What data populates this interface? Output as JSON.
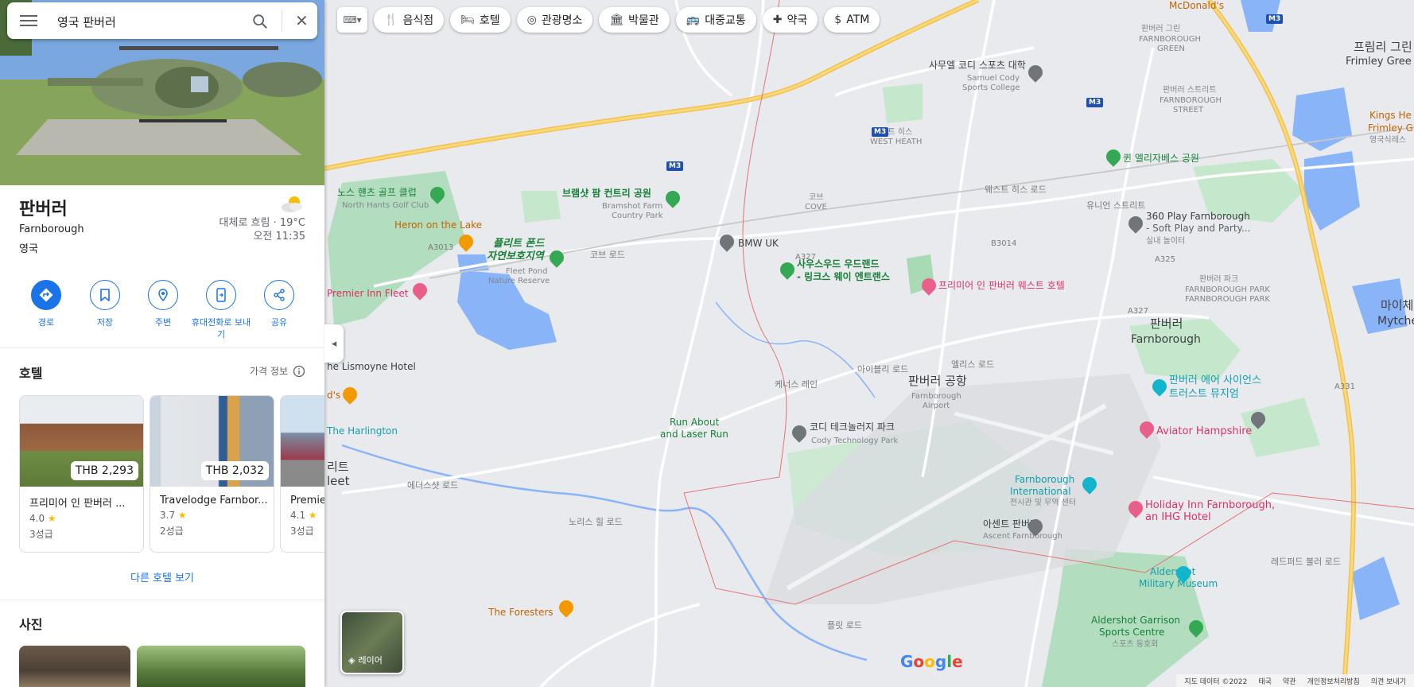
{
  "search": {
    "query": "영국 판버러"
  },
  "place": {
    "name": "판버러",
    "subtitle": "Farnborough",
    "country": "영국",
    "weather_line": "대체로 흐림 · 19°C",
    "time": "오전 11:35"
  },
  "actions": [
    {
      "label": "경로",
      "icon": "directions-icon"
    },
    {
      "label": "저장",
      "icon": "bookmark-icon"
    },
    {
      "label": "주변",
      "icon": "nearby-icon"
    },
    {
      "label": "휴대전화로 보내기",
      "icon": "send-to-phone-icon"
    },
    {
      "label": "공유",
      "icon": "share-icon"
    }
  ],
  "hotels": {
    "title": "호텔",
    "price_info": "가격 정보",
    "items": [
      {
        "price": "THB 2,293",
        "name": "프리미어 인 판버러 ...",
        "rating": "4.0",
        "class": "3성급"
      },
      {
        "price": "THB 2,032",
        "name": "Travelodge Farnbor...",
        "rating": "3.7",
        "class": "2성급"
      },
      {
        "price": "",
        "name": "Premier...",
        "rating": "4.1",
        "class": "3성급"
      }
    ],
    "more": "다른 호텔 보기"
  },
  "photos": {
    "title": "사진"
  },
  "chips": [
    {
      "label": "음식점",
      "icon": "fork-knife-icon"
    },
    {
      "label": "호텔",
      "icon": "bed-icon"
    },
    {
      "label": "관광명소",
      "icon": "camera-icon"
    },
    {
      "label": "박물관",
      "icon": "museum-icon"
    },
    {
      "label": "대중교통",
      "icon": "bus-icon"
    },
    {
      "label": "약국",
      "icon": "pharmacy-icon"
    },
    {
      "label": "ATM",
      "icon": "atm-icon"
    }
  ],
  "map_labels": {
    "fleet_pond_1": "플리트 폰드",
    "fleet_pond_2": "자연보호지역",
    "fleet_pond_en1": "Fleet Pond",
    "fleet_pond_en2": "Nature Reserve",
    "north_hants": "노스 햰츠 골프 클럽",
    "north_hants_en": "North Hants Golf Club",
    "bramshot": "브램샷 팜 컨트리 공원",
    "bramshot_en1": "Bramshot Farm",
    "bramshot_en2": "Country Park",
    "heron": "Heron on the Lake",
    "premier_fleet": "Premier Inn Fleet",
    "lismoyne": "he Lismoyne Hotel",
    "harlington": "The Harlington",
    "bmw": "BMW UK",
    "southwood_1": "사우스우드 우드랜드",
    "southwood_2": "- 링크스 웨이 엔트랜스",
    "premier_fw": "프리미어 인 판버러 웨스트 호텔",
    "samuel_cody": "사무엘 코디 스포츠 대학",
    "samuel_cody_en1": "Samuel Cody",
    "samuel_cody_en2": "Sports College",
    "west_heath": "웨스트 히스",
    "west_heath_en": "WEST HEATH",
    "cove": "코브",
    "cove_en": "COVE",
    "queen_eliz": "퀸 엘리자베스 공원",
    "play360_1": "360 Play Farnborough",
    "play360_2": "- Soft Play and Party...",
    "play360_kr": "실내 놀이터",
    "farnborough_park": "판버러 파크",
    "farnborough_park_en": "FARNBOROUGH PARK",
    "farnborough_street": "판버러 스트리트",
    "farnborough_street_en1": "FARNBOROUGH",
    "farnborough_street_en2": "STREET",
    "farnborough_green": "판버러 그린",
    "farnborough_green_en1": "FARNBOROUGH",
    "farnborough_green_en2": "GREEN",
    "frimley_green": "프림리 그린",
    "frimley_green_en": "Frimley Gree",
    "kings_head_1": "Kings He",
    "kings_head_2": "Frimley Gre",
    "kings_head_3": "영국식레스",
    "farnborough_big": "판버러",
    "farnborough_big_en": "Farnborough",
    "airport": "판버러 공항",
    "airport_en1": "Farnborough",
    "airport_en2": "Airport",
    "fast_museum_1": "판버러 에어 사이언스",
    "fast_museum_2": "트러스트 뮤지엄",
    "aviator": "Aviator Hampshire",
    "cody_tech": "코디 테크놀러지 파크",
    "cody_tech_en": "Cody Technology Park",
    "run_about_1": "Run About",
    "run_about_2": "and Laser Run",
    "fb_intl_1": "Farnborough",
    "fb_intl_2": "International",
    "fb_intl_3": "전시관 및 무역 센터",
    "holiday_inn_1": "Holiday Inn Farnborough,",
    "holiday_inn_2": "an IHG Hotel",
    "ascent_kr": "아센트 판버러",
    "ascent_en": "Ascent Farnborough",
    "aldershot_mm_1": "Aldershot",
    "aldershot_mm_2": "Military Museum",
    "aldershot_gsc_1": "Aldershot Garrison",
    "aldershot_gsc_2": "Sports Centre",
    "aldershot_gsc_3": "스포츠 동호회",
    "foresters": "The Foresters",
    "fleet_partial_1": "리트",
    "fleet_partial_2": "leet",
    "mytchett_1": "마이체",
    "mytchett_2": "Mytche",
    "mcdonalds": "McDonald's",
    "ds_partial": "d's",
    "road_cove": "코브 로드",
    "road_elles": "엘리스 로드",
    "road_kennels": "케너스 레인",
    "road_ively": "아이블리 로드",
    "road_norris": "노리스 힐 로드",
    "road_eddy": "에더스샷 로드",
    "road_fleet": "플릿 로드",
    "road_union": "유니언 스트리트",
    "road_west_heath": "웨스트 히스 로드",
    "road_lynchford": "레드퍼드 불러 로드",
    "road_m3": "M3",
    "road_a327": "A327",
    "road_a325": "A325",
    "road_a331": "A331",
    "road_a3013": "A3013",
    "road_b3014": "B3014"
  },
  "layers": {
    "label": "레이어"
  },
  "footer": {
    "map_data": "지도 데이터 ©2022",
    "country": "태국",
    "terms": "약관",
    "privacy": "개인정보처리방침",
    "feedback": "의견 보내기"
  },
  "google_logo": "Google"
}
